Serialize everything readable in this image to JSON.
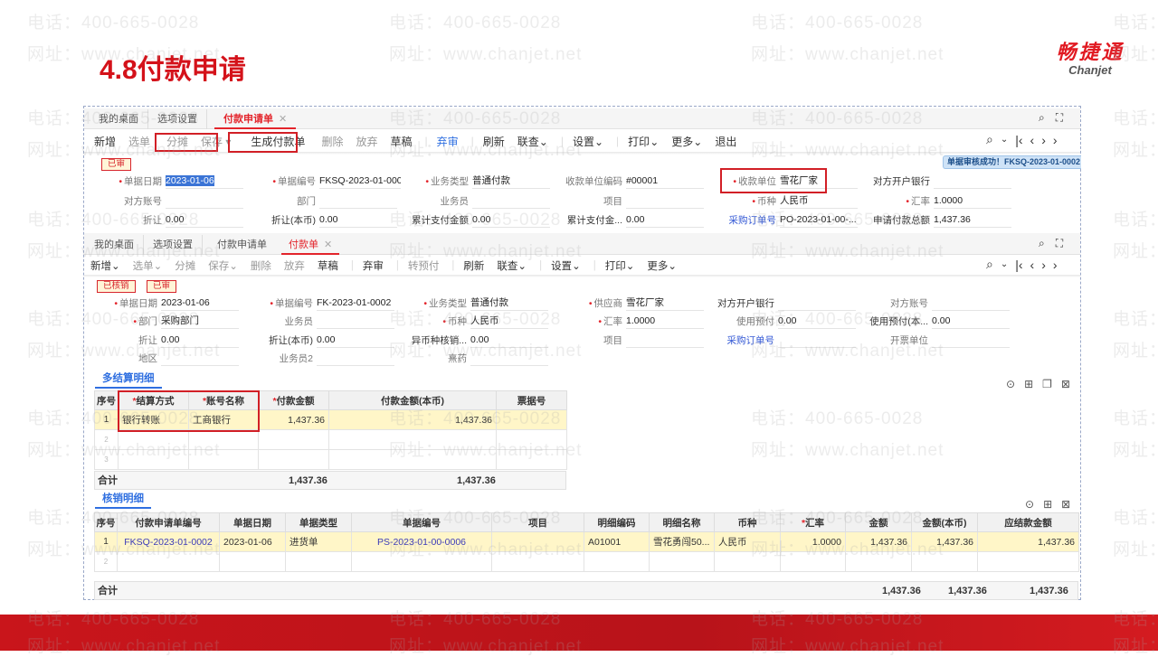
{
  "slide_title": "4.8付款申请",
  "logo": {
    "cn": "畅捷通",
    "en": "Chanjet"
  },
  "watermark": {
    "phone": "电话：400-665-0028",
    "site": "网址：www.chanjet.net"
  },
  "win1": {
    "tabs": [
      "我的桌面",
      "选项设置",
      "付款申请单"
    ],
    "toolbar": [
      "新增",
      "选单",
      "分摊",
      "保存",
      "生成付款单",
      "删除",
      "放弃",
      "草稿",
      "弃审",
      "刷新",
      "联查",
      "设置",
      "打印",
      "更多",
      "退出"
    ],
    "badge": "已审",
    "toast": "单据审核成功！FKSQ-2023-01-0002",
    "fields": {
      "date": {
        "label": "单据日期",
        "value": "2023-01-06"
      },
      "code": {
        "label": "单据编号",
        "value": "FKSQ-2023-01-0002"
      },
      "biztype": {
        "label": "业务类型",
        "value": "普通付款"
      },
      "payee_code": {
        "label": "收款单位编码",
        "value": "#00001"
      },
      "payee": {
        "label": "收款单位",
        "value": "雪花厂家"
      },
      "bank": {
        "label": "对方开户银行",
        "value": ""
      },
      "account": {
        "label": "对方账号",
        "value": ""
      },
      "dept": {
        "label": "部门",
        "value": ""
      },
      "staff": {
        "label": "业务员",
        "value": ""
      },
      "project": {
        "label": "项目",
        "value": ""
      },
      "currency": {
        "label": "币种",
        "value": "人民币"
      },
      "rate": {
        "label": "汇率",
        "value": "1.0000"
      },
      "discount": {
        "label": "折让",
        "value": "0.00"
      },
      "discount_local": {
        "label": "折让(本币)",
        "value": "0.00"
      },
      "paid_total": {
        "label": "累计支付金额",
        "value": "0.00"
      },
      "paid_total2": {
        "label": "累计支付金...",
        "value": "0.00"
      },
      "po": {
        "label": "采购订单号",
        "value": "PO-2023-01-00-..."
      },
      "apply_total": {
        "label": "申请付款总额",
        "value": "1,437.36"
      }
    }
  },
  "win2": {
    "tabs": [
      "我的桌面",
      "选项设置",
      "付款申请单",
      "付款单"
    ],
    "toolbar": [
      "新增",
      "选单",
      "分摊",
      "保存",
      "删除",
      "放弃",
      "草稿",
      "弃审",
      "转预付",
      "刷新",
      "联查",
      "设置",
      "打印",
      "更多"
    ],
    "badges": [
      "已核销",
      "已审"
    ],
    "fields": {
      "date": {
        "label": "单据日期",
        "value": "2023-01-06"
      },
      "code": {
        "label": "单据编号",
        "value": "FK-2023-01-0002"
      },
      "biztype": {
        "label": "业务类型",
        "value": "普通付款"
      },
      "supplier": {
        "label": "供应商",
        "value": "雪花厂家"
      },
      "bank": {
        "label": "对方开户银行",
        "value": ""
      },
      "account": {
        "label": "对方账号",
        "value": ""
      },
      "dept": {
        "label": "部门",
        "value": "采购部门"
      },
      "staff": {
        "label": "业务员",
        "value": ""
      },
      "currency": {
        "label": "币种",
        "value": "人民币"
      },
      "rate": {
        "label": "汇率",
        "value": "1.0000"
      },
      "prepay": {
        "label": "使用预付",
        "value": "0.00"
      },
      "prepay_local": {
        "label": "使用预付(本...",
        "value": "0.00"
      },
      "discount": {
        "label": "折让",
        "value": "0.00"
      },
      "discount_local": {
        "label": "折让(本币)",
        "value": "0.00"
      },
      "fx_writeoff": {
        "label": "异币种核销...",
        "value": "0.00"
      },
      "project": {
        "label": "项目",
        "value": ""
      },
      "po": {
        "label": "采购订单号",
        "value": ""
      },
      "invoice_unit": {
        "label": "开票单位",
        "value": ""
      },
      "region": {
        "label": "地区",
        "value": ""
      },
      "staff2": {
        "label": "业务员2",
        "value": ""
      },
      "drug": {
        "label": "熹药",
        "value": ""
      }
    },
    "settle": {
      "title": "多结算明细",
      "headers": [
        "序号",
        "结算方式",
        "账号名称",
        "付款金额",
        "付款金额(本币)",
        "票据号"
      ],
      "rows": [
        [
          "1",
          "银行转账",
          "工商银行",
          "1,437.36",
          "1,437.36",
          ""
        ]
      ],
      "empty_rows": [
        "2",
        "3"
      ],
      "total_label": "合计",
      "total_amount": "1,437.36",
      "total_local": "1,437.36"
    },
    "writeoff": {
      "title": "核销明细",
      "headers": [
        "序号",
        "付款申请单编号",
        "单据日期",
        "单据类型",
        "单据编号",
        "项目",
        "明细编码",
        "明细名称",
        "币种",
        "汇率",
        "金额",
        "金额(本币)",
        "应结款金额"
      ],
      "rows": [
        [
          "1",
          "FKSQ-2023-01-0002",
          "2023-01-06",
          "进货单",
          "PS-2023-01-00-0006",
          "",
          "A01001",
          "雪花勇闯50...",
          "人民币",
          "1.0000",
          "1,437.36",
          "1,437.36",
          "1,437.36"
        ]
      ],
      "empty_rows": [
        "2"
      ],
      "total_label": "合计",
      "total_amount": "1,437.36",
      "total_local": "1,437.36",
      "total_settle": "1,437.36"
    }
  }
}
